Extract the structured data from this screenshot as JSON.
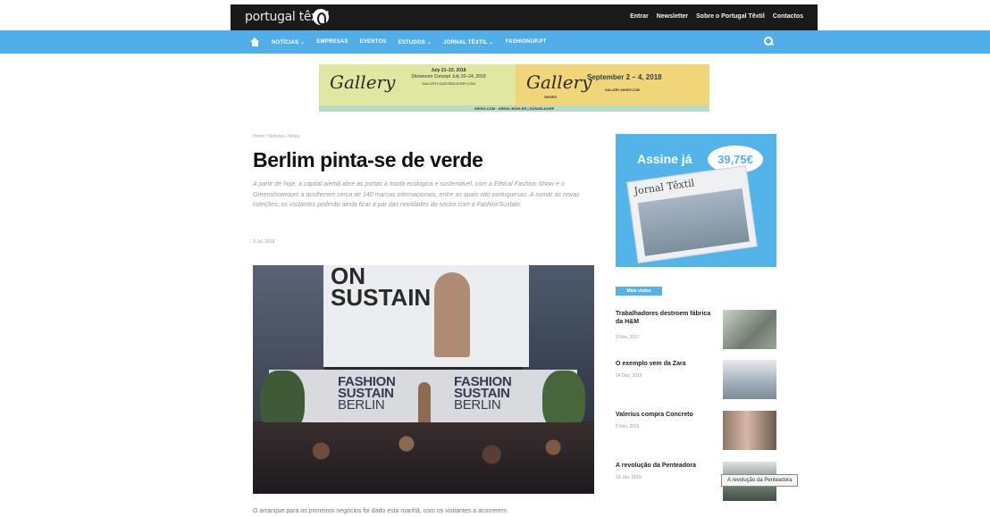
{
  "header": {
    "logo_text": "portugal têxtil",
    "top_links": [
      "Entrar",
      "Newsletter",
      "Sobre o Portugal Têxtil",
      "Contactos"
    ]
  },
  "nav": {
    "items": [
      "NOTÍCIAS ⌄",
      "EMPRESAS",
      "EVENTOS",
      "ESTUDOS ⌄",
      "JORNAL TÊXTIL ⌄",
      "FASHIONUP.PT"
    ]
  },
  "banner": {
    "left_logo": "Gallery",
    "left_dates": "July 21–23, 2018",
    "left_subdates": "Showroom Concept July 20–24, 2018",
    "left_site": "GALLERY-DUESSELDORF.COM",
    "right_logo": "Gallery",
    "right_label": "SHOES",
    "right_dates": "September 2 – 4, 2018",
    "right_site": "GALLERY-SHOES.COM",
    "bottom_text": "IGEDO.COM · AREAL BÖHLER | DÜSSELDORF"
  },
  "article": {
    "breadcrumb": "Home / Notícias / Moda",
    "title": "Berlim pinta-se de verde",
    "lead": "A partir de hoje, a capital alemã abre as portas à moda ecológica e sustentável, com a Ethical Fashion Show e o Greenshowroom a acolherem cerca de 140 marcas internacionais, entre as quais oito portuguesas. A somar às novas coleções, os visitantes poderão ainda ficar a par das novidades do sector com a FashionSustain.",
    "date": "3 Jul, 2018",
    "image_text": {
      "screen": "SUSTAIN",
      "screen_top": "ON",
      "stage_left_1": "FASHION",
      "stage_left_2": "SUSTAIN",
      "stage_left_3": "BERLIN",
      "stage_right_1": "FASHION",
      "stage_right_2": "SUSTAIN",
      "stage_right_3": "BERLIN"
    },
    "body_start": "O arranque para os primeiros negócios foi dado esta manhã, com os visitantes a acorrerem"
  },
  "sidebar": {
    "ad": {
      "title": "Assine já",
      "price": "39,75€",
      "price_sub": "ano",
      "paper_title": "Jornal Têxtil"
    },
    "most_read_label": "Mais vistos",
    "news": [
      {
        "title": "Trabalhadores destroem fábrica da H&M",
        "date": "9 Nov, 2017"
      },
      {
        "title": "O exemplo vem da Zara",
        "date": "24 Dez, 2015"
      },
      {
        "title": "Valerius compra Concreto",
        "date": "5 Nov, 2015"
      },
      {
        "title": "A revolução da Penteadora",
        "date": "19 Jan, 2016"
      }
    ]
  },
  "tooltip": "A revolução da Penteadora"
}
